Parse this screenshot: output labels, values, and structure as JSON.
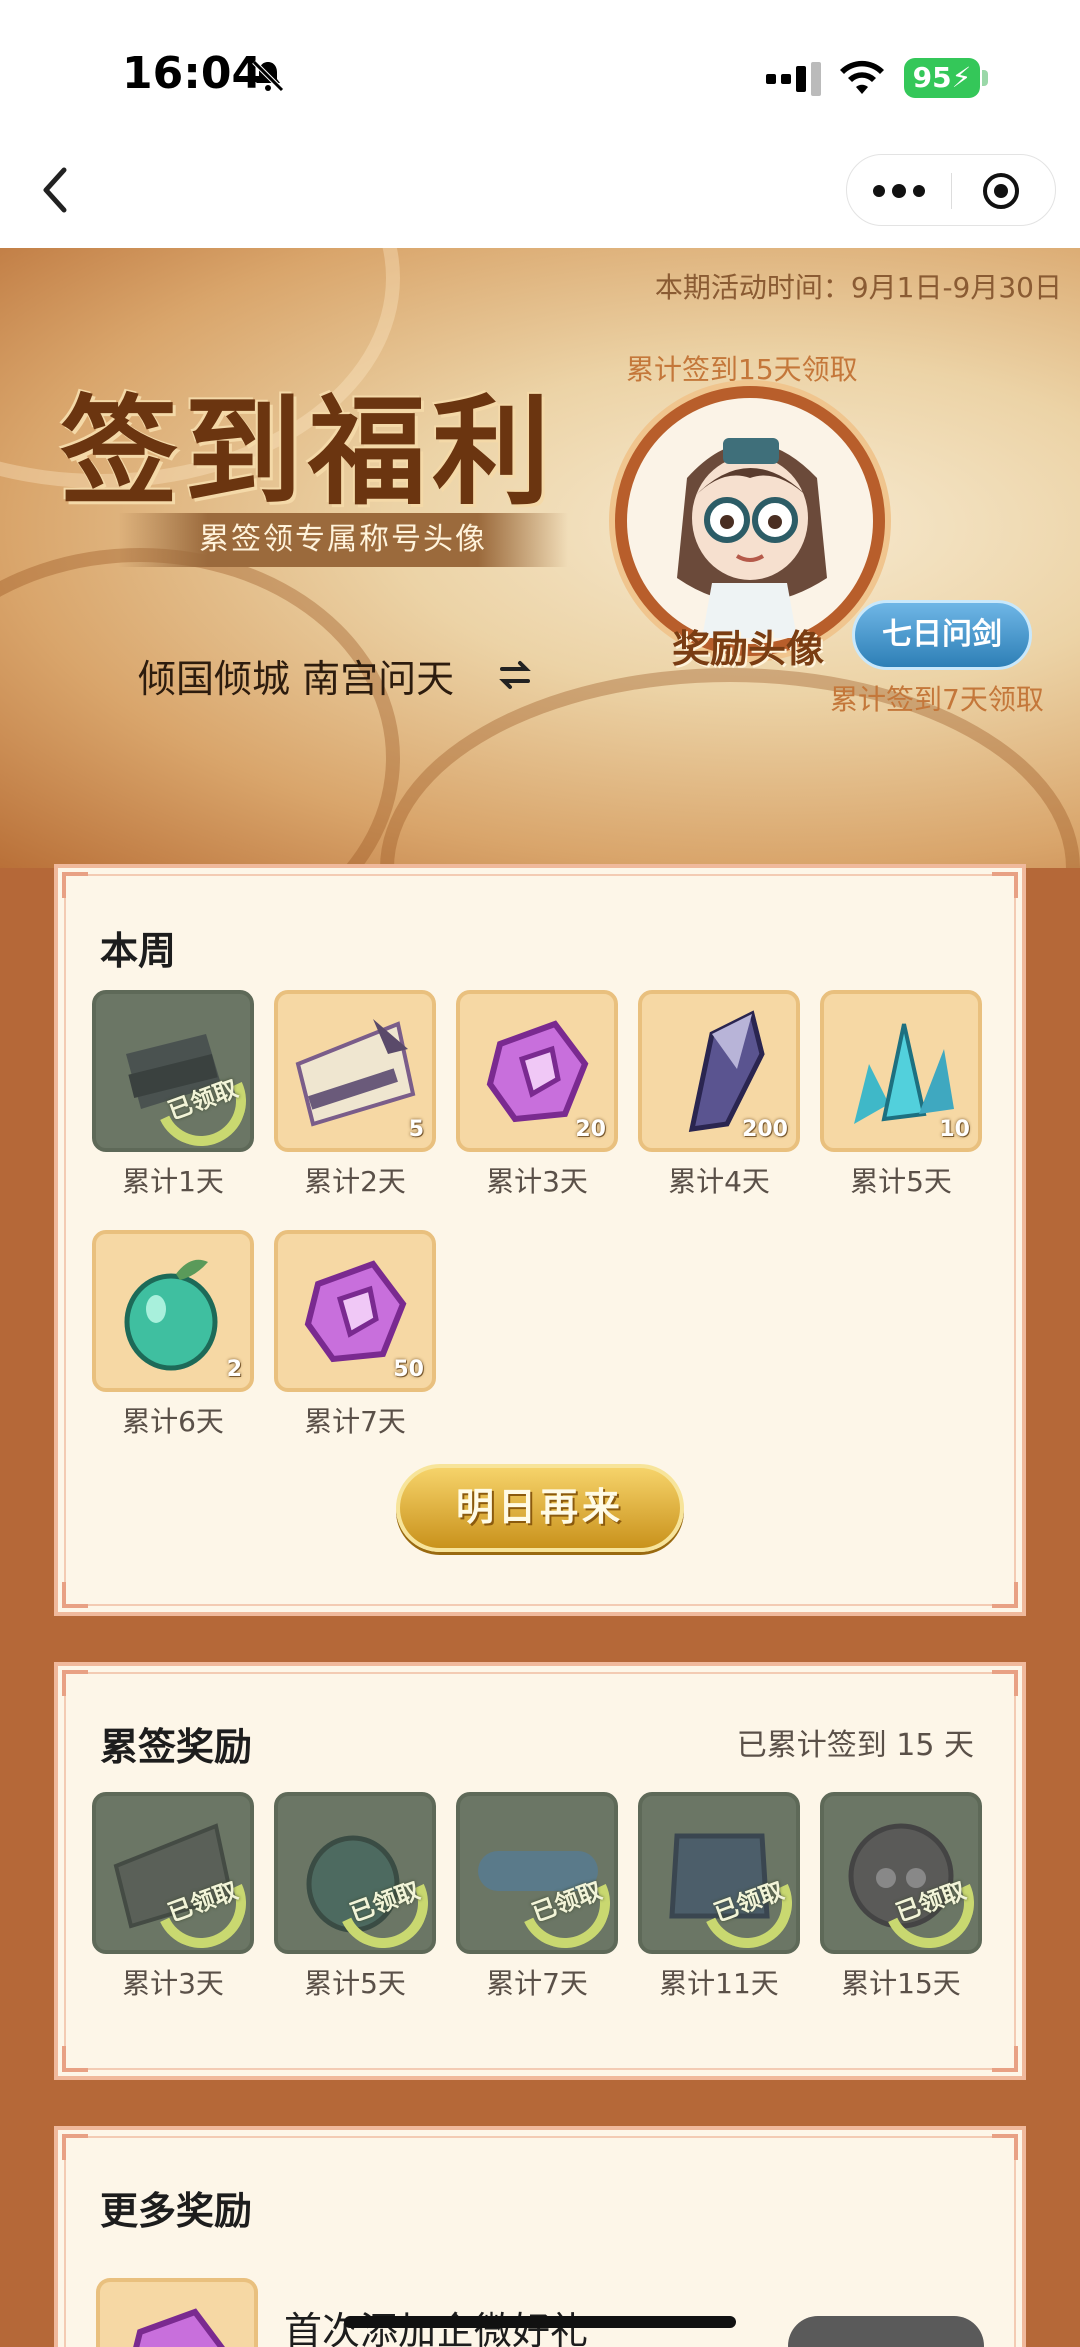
{
  "status_bar": {
    "time": "16:04",
    "battery": "95"
  },
  "banner": {
    "period": "本期活动时间：9月1日-9月30日",
    "title": "签到福利",
    "subtitle": "累签领专属称号头像",
    "avatar_hint": "累计签到15天领取",
    "avatar_label": "奖励头像",
    "badge": "七日问剑",
    "badge_hint": "累计签到7天领取",
    "server": "倾国倾城  南宫问天"
  },
  "week": {
    "title": "本周",
    "items": [
      {
        "label": "累计1天",
        "qty": "",
        "claimed": true,
        "icon": "scroll-icon",
        "stamp": "已领取"
      },
      {
        "label": "累计2天",
        "qty": "5",
        "claimed": false,
        "icon": "scroll-icon"
      },
      {
        "label": "累计3天",
        "qty": "20",
        "claimed": false,
        "icon": "purple-crystal-icon"
      },
      {
        "label": "累计4天",
        "qty": "200",
        "claimed": false,
        "icon": "dark-crystal-icon"
      },
      {
        "label": "累计5天",
        "qty": "10",
        "claimed": false,
        "icon": "cyan-crystal-icon"
      },
      {
        "label": "累计6天",
        "qty": "2",
        "claimed": false,
        "icon": "jade-gourd-icon"
      },
      {
        "label": "累计7天",
        "qty": "50",
        "claimed": false,
        "icon": "purple-crystal-icon"
      }
    ],
    "button": "明日再来"
  },
  "cumulative": {
    "title": "累签奖励",
    "count": "已累计签到 15 天",
    "items": [
      {
        "label": "累计3天",
        "stamp": "已领取",
        "icon": "scroll-icon"
      },
      {
        "label": "累计5天",
        "stamp": "已领取",
        "icon": "jade-gourd-icon"
      },
      {
        "label": "累计7天",
        "stamp": "已领取",
        "icon": "title-badge-icon"
      },
      {
        "label": "累计11天",
        "stamp": "已领取",
        "icon": "frame-icon"
      },
      {
        "label": "累计15天",
        "stamp": "已领取",
        "icon": "avatar-icon"
      }
    ]
  },
  "more": {
    "title": "更多奖励",
    "row_title": "首次添加企微好礼"
  }
}
